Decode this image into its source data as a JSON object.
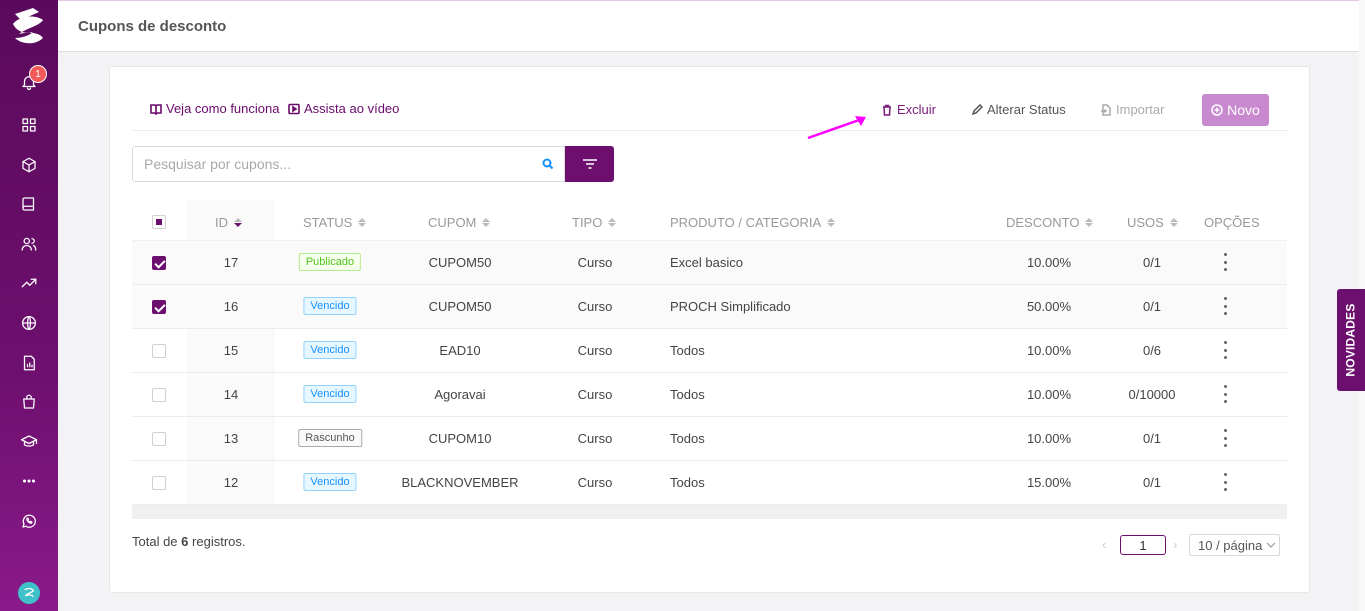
{
  "header": {
    "title": "Cupons de desconto"
  },
  "sidebar": {
    "notification_count": "1"
  },
  "toolbar": {
    "how_it_works": "Veja como funciona",
    "watch_video": "Assista ao vídeo",
    "delete": "Excluir",
    "change_status": "Alterar Status",
    "import": "Importar",
    "new": "Novo"
  },
  "search": {
    "placeholder": "Pesquisar por cupons..."
  },
  "table": {
    "columns": [
      "ID",
      "STATUS",
      "CUPOM",
      "TIPO",
      "PRODUTO / CATEGORIA",
      "DESCONTO",
      "USOS",
      "OPÇÕES"
    ],
    "rows": [
      {
        "selected": true,
        "id": "17",
        "status": "Publicado",
        "status_type": "pub",
        "cupom": "CUPOM50",
        "tipo": "Curso",
        "produto": "Excel basico",
        "desconto": "10.00%",
        "usos": "0/1"
      },
      {
        "selected": true,
        "id": "16",
        "status": "Vencido",
        "status_type": "venc",
        "cupom": "CUPOM50",
        "tipo": "Curso",
        "produto": "PROCH Simplificado",
        "desconto": "50.00%",
        "usos": "0/1"
      },
      {
        "selected": false,
        "id": "15",
        "status": "Vencido",
        "status_type": "venc",
        "cupom": "EAD10",
        "tipo": "Curso",
        "produto": "Todos",
        "desconto": "10.00%",
        "usos": "0/6"
      },
      {
        "selected": false,
        "id": "14",
        "status": "Vencido",
        "status_type": "venc",
        "cupom": "Agoravai",
        "tipo": "Curso",
        "produto": "Todos",
        "desconto": "10.00%",
        "usos": "0/10000"
      },
      {
        "selected": false,
        "id": "13",
        "status": "Rascunho",
        "status_type": "rasc",
        "cupom": "CUPOM10",
        "tipo": "Curso",
        "produto": "Todos",
        "desconto": "10.00%",
        "usos": "0/1"
      },
      {
        "selected": false,
        "id": "12",
        "status": "Vencido",
        "status_type": "venc",
        "cupom": "BLACKNOVEMBER",
        "tipo": "Curso",
        "produto": "Todos",
        "desconto": "15.00%",
        "usos": "0/1"
      }
    ]
  },
  "footer": {
    "total_prefix": "Total de",
    "total_count": "6",
    "total_suffix": "registros.",
    "current_page": "1",
    "page_size": "10 / página"
  },
  "side_tab": {
    "label": "NOVIDADES"
  },
  "colors": {
    "brand": "#6d0f6e",
    "accent_light": "#c989cf",
    "arrow": "#ff00ff"
  }
}
